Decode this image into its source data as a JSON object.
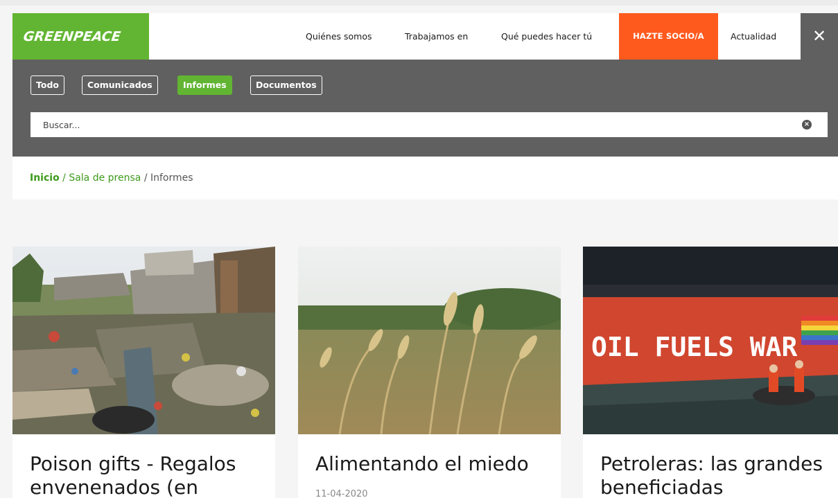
{
  "header": {
    "logo_text": "GREENPEACE",
    "nav": [
      "Quiénes somos",
      "Trabajamos en",
      "Qué puedes hacer tú"
    ],
    "cta": "HAZTE SOCIO/A",
    "last_nav": "Actualidad",
    "close_symbol": "✕"
  },
  "filters": [
    {
      "label": "Todo",
      "active": false
    },
    {
      "label": "Comunicados",
      "active": false
    },
    {
      "label": "Informes",
      "active": true
    },
    {
      "label": "Documentos",
      "active": false
    }
  ],
  "search": {
    "placeholder": "Buscar...",
    "clear_symbol": "×"
  },
  "breadcrumb": {
    "home": "Inicio",
    "sep": "/",
    "section": "Sala de prensa",
    "current": "Informes"
  },
  "cards": [
    {
      "title": "Poison gifts - Regalos envenenados (en",
      "date": "",
      "image": "slum-waste-photo"
    },
    {
      "title": "Alimentando el miedo",
      "date": "11-04-2020",
      "image": "wheat-field-photo"
    },
    {
      "title": "Petroleras: las grandes beneficiadas",
      "date": "",
      "image": "oil-fuels-war-ship-photo"
    }
  ],
  "ship_text": "OIL FUELS WAR",
  "colors": {
    "brand_green": "#62b532",
    "cta_orange": "#ff5a1e",
    "panel_gray": "#606060",
    "link_green": "#3d9a1b"
  }
}
